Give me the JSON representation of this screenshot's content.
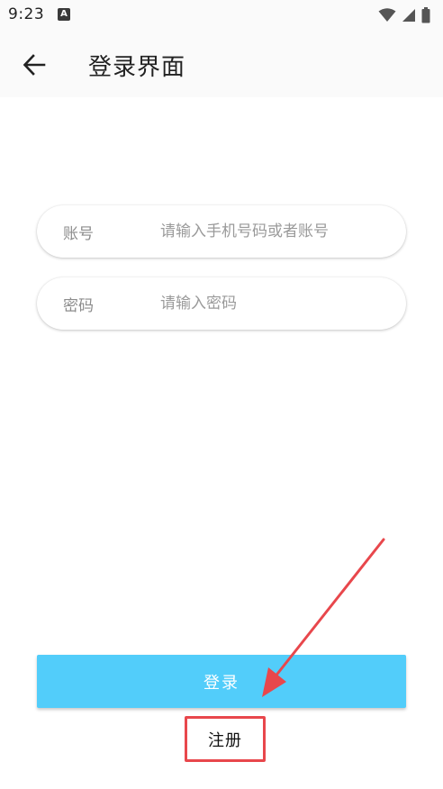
{
  "status_bar": {
    "time": "9:23",
    "notification_icon": "A",
    "icons": [
      "wifi-icon",
      "signal-icon",
      "battery-icon"
    ]
  },
  "app_bar": {
    "back_icon": "arrow-left-icon",
    "title": "登录界面"
  },
  "form": {
    "account": {
      "label": "账号",
      "placeholder": "请输入手机号码或者账号",
      "value": ""
    },
    "password": {
      "label": "密码",
      "placeholder": "请输入密码",
      "value": ""
    },
    "login_label": "登录",
    "register_label": "注册"
  },
  "colors": {
    "login_button": "#52cdfa",
    "annotation": "#e8474c",
    "bar_background": "#fafafa"
  }
}
